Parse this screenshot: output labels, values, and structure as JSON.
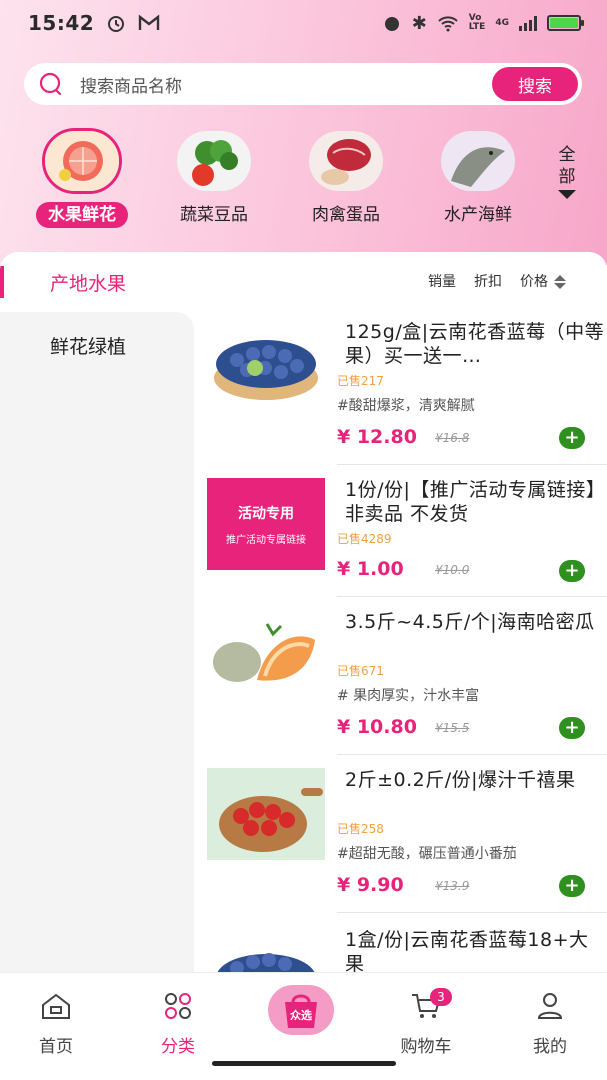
{
  "status": {
    "time": "15:42",
    "battery_pct": 100,
    "net": "4G"
  },
  "search": {
    "placeholder": "搜索商品名称",
    "button": "搜索"
  },
  "categories": [
    {
      "label": "水果鲜花",
      "icon": "grapefruit-image",
      "active": true
    },
    {
      "label": "蔬菜豆品",
      "icon": "broccoli-tomato-image",
      "active": false
    },
    {
      "label": "肉禽蛋品",
      "icon": "meat-image",
      "active": false
    },
    {
      "label": "水产海鲜",
      "icon": "fish-image",
      "active": false
    }
  ],
  "all_categories": {
    "line1": "全",
    "line2": "部"
  },
  "sidebar": {
    "items": [
      {
        "label": "产地水果",
        "active": true
      },
      {
        "label": "鲜花绿植",
        "active": false
      }
    ]
  },
  "sorts": {
    "sales": "销量",
    "discount": "折扣",
    "price": "价格"
  },
  "products": [
    {
      "title": "125g/盒|云南花香蓝莓（中等果）买一送一…",
      "sold": "已售217",
      "tag": "#酸甜爆浆，清爽解腻",
      "price": "¥ 12.80",
      "orig": "¥16.8",
      "image": "blueberry-bowl-image"
    },
    {
      "title": "1份/份|【推广活动专属链接】非卖品 不发货",
      "sold": "已售4289",
      "tag": "",
      "price": "¥ 1.00",
      "orig": "¥10.0",
      "image": "promo-banner",
      "promo_line1": "活动专用",
      "promo_line2": "推广活动专属链接"
    },
    {
      "title": "3.5斤~4.5斤/个|海南哈密瓜",
      "sold": "已售671",
      "tag": "# 果肉厚实，汁水丰富",
      "price": "¥ 10.80",
      "orig": "¥15.5",
      "image": "hami-melon-image"
    },
    {
      "title": "2斤±0.2斤/份|爆汁千禧果",
      "sold": "已售258",
      "tag": "#超甜无酸，碾压普通小番茄",
      "price": "¥ 9.90",
      "orig": "¥13.9",
      "image": "cherry-tomato-image"
    },
    {
      "title": "1盒/份|云南花香蓝莓18+大果",
      "sold": "",
      "tag": "",
      "price": "",
      "orig": "",
      "image": "blueberry-bowl-image"
    }
  ],
  "tabbar": {
    "home": "首页",
    "category": "分类",
    "center_logo_text": "众选",
    "cart": "购物车",
    "cart_badge": "3",
    "mine": "我的"
  },
  "colors": {
    "accent": "#e8237b",
    "add_button": "#2f8f1f",
    "sold_text": "#f0a040"
  }
}
